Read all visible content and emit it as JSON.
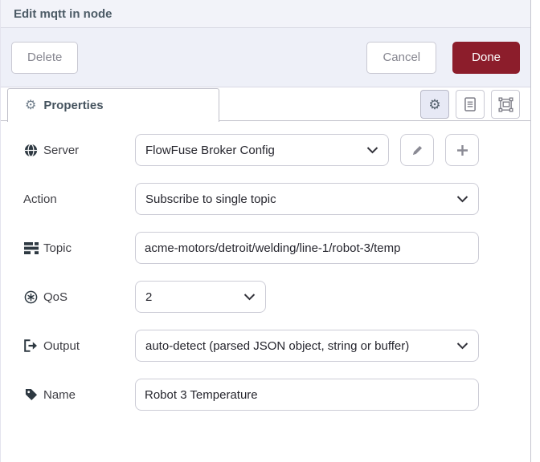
{
  "dialog": {
    "title": "Edit mqtt in node"
  },
  "buttons": {
    "delete": "Delete",
    "cancel": "Cancel",
    "done": "Done"
  },
  "tab": {
    "properties_label": "Properties",
    "tab_gear": "⚙",
    "tool_gear": "⚙"
  },
  "form": {
    "server": {
      "label": "Server",
      "value": "FlowFuse Broker Config"
    },
    "action": {
      "label": "Action",
      "value": "Subscribe to single topic"
    },
    "topic": {
      "label": "Topic",
      "value": "acme-motors/detroit/welding/line-1/robot-3/temp"
    },
    "qos": {
      "label": "QoS",
      "value": "2"
    },
    "output": {
      "label": "Output",
      "value": "auto-detect (parsed JSON object, string or buffer)"
    },
    "name": {
      "label": "Name",
      "value": "Robot 3 Temperature"
    }
  },
  "icons": {
    "server": "globe-icon",
    "topic": "tasks-icon",
    "qos": "circled-asterisk-icon",
    "output": "sign-out-icon",
    "name": "tag-icon",
    "tab_tools": [
      "gear-icon",
      "document-icon",
      "object-group-icon"
    ],
    "server_actions": [
      "pencil-icon",
      "plus-icon"
    ]
  },
  "colors": {
    "done_bg": "#8c1d2b",
    "header_bg": "#f2f3f9",
    "bar_bg": "#eef0f8",
    "active_tool_bg": "#e7e9f5",
    "input_border": "#ccccd6",
    "title_text": "#4c5b66",
    "muted_button_text": "#85858f",
    "label_text": "#3e3e44"
  }
}
